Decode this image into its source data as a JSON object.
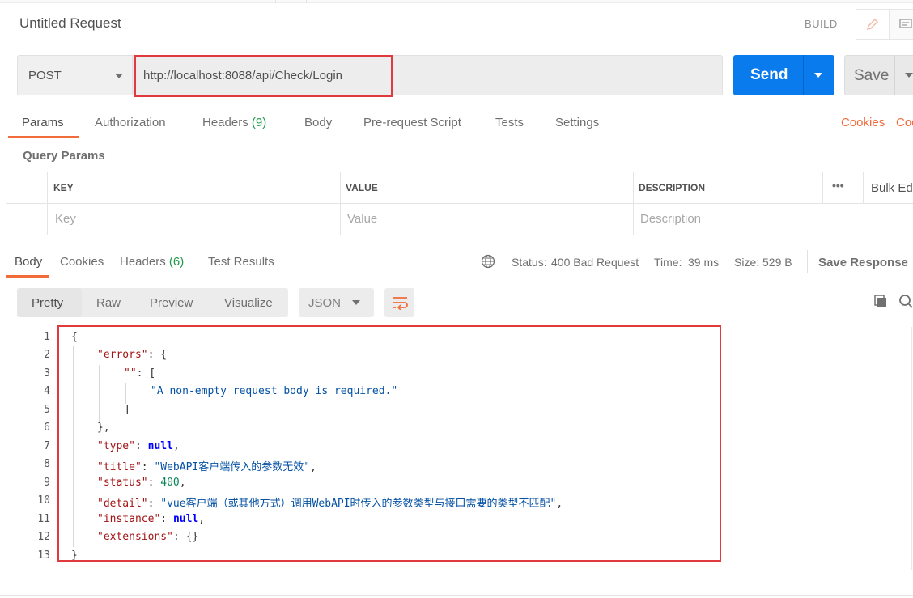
{
  "header": {
    "title": "Untitled Request",
    "build_label": "BUILD"
  },
  "request": {
    "method": "POST",
    "url": "http://localhost:8088/api/Check/Login",
    "send_label": "Send",
    "save_label": "Save"
  },
  "request_tabs": {
    "params": "Params",
    "authorization": "Authorization",
    "headers": "Headers",
    "headers_count": "(9)",
    "body": "Body",
    "prerequest": "Pre-request Script",
    "tests": "Tests",
    "settings": "Settings",
    "cookies": "Cookies",
    "code": "Cod"
  },
  "query_params": {
    "title": "Query Params",
    "columns": {
      "key": "KEY",
      "value": "VALUE",
      "description": "DESCRIPTION"
    },
    "more": "•••",
    "bulk_edit": "Bulk Ed",
    "placeholders": {
      "key": "Key",
      "value": "Value",
      "description": "Description"
    }
  },
  "response_tabs": {
    "body": "Body",
    "cookies": "Cookies",
    "headers": "Headers",
    "headers_count": "(6)",
    "test_results": "Test Results"
  },
  "response_meta": {
    "status_label": "Status:",
    "status_value": "400 Bad Request",
    "time_label": "Time:",
    "time_value": "39 ms",
    "size_label": "Size:",
    "size_value": "529 B",
    "save_response": "Save Response"
  },
  "format_bar": {
    "pretty": "Pretty",
    "raw": "Raw",
    "preview": "Preview",
    "visualize": "Visualize",
    "language": "JSON"
  },
  "code": {
    "line_numbers": [
      "1",
      "2",
      "3",
      "4",
      "5",
      "6",
      "7",
      "8",
      "9",
      "10",
      "11",
      "12",
      "13"
    ],
    "l1_open": "{",
    "l2_key": "\"errors\"",
    "l2_rest": ": {",
    "l3_key": "\"\"",
    "l3_rest": ": [",
    "l4_str": "\"A non-empty request body is required.\"",
    "l5": "]",
    "l6": "},",
    "l7_key": "\"type\"",
    "l7_val": "null",
    "l8_key": "\"title\"",
    "l8_val": "\"WebAPI客户端传入的参数无效\"",
    "l9_key": "\"status\"",
    "l9_val": "400",
    "l10_key": "\"detail\"",
    "l10_val": "\"vue客户端（或其他方式）调用WebAPI时传入的参数类型与接口需要的类型不匹配\"",
    "l11_key": "\"instance\"",
    "l11_val": "null",
    "l12_key": "\"extensions\"",
    "l12_val": "{}",
    "l13_close": "}",
    "colon": ": ",
    "comma": ","
  },
  "colors": {
    "accent": "#f26b3a",
    "send": "#097bed",
    "success": "#1d9a4b",
    "highlight": "#e0393e"
  }
}
